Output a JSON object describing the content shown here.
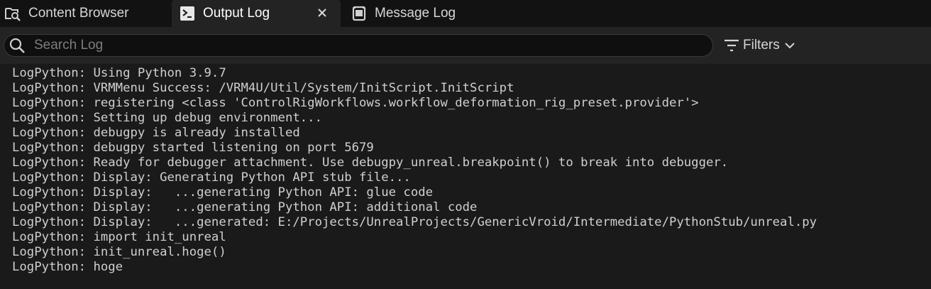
{
  "tabs": [
    {
      "label": "Content Browser",
      "icon": "content-browser-icon",
      "active": false
    },
    {
      "label": "Output Log",
      "icon": "terminal-icon",
      "active": true
    },
    {
      "label": "Message Log",
      "icon": "message-log-icon",
      "active": false
    }
  ],
  "search": {
    "placeholder": "Search Log",
    "value": ""
  },
  "filters": {
    "label": "Filters"
  },
  "log": {
    "lines": [
      "LogPython: Using Python 3.9.7",
      "LogPython: VRMMenu Success: /VRM4U/Util/System/InitScript.InitScript",
      "LogPython: registering <class 'ControlRigWorkflows.workflow_deformation_rig_preset.provider'>",
      "LogPython: Setting up debug environment...",
      "LogPython: debugpy is already installed",
      "LogPython: debugpy started listening on port 5679",
      "LogPython: Ready for debugger attachment. Use debugpy_unreal.breakpoint() to break into debugger.",
      "LogPython: Display: Generating Python API stub file...",
      "LogPython: Display:   ...generating Python API: glue code",
      "LogPython: Display:   ...generating Python API: additional code",
      "LogPython: Display:   ...generated: E:/Projects/UnrealProjects/GenericVroid/Intermediate/PythonStub/unreal.py",
      "LogPython: import init_unreal",
      "LogPython: init_unreal.hoge()",
      "LogPython: hoge"
    ]
  },
  "colors": {
    "background": "#151515",
    "active_tab": "#232323",
    "log_text": "#cfcfcf"
  }
}
